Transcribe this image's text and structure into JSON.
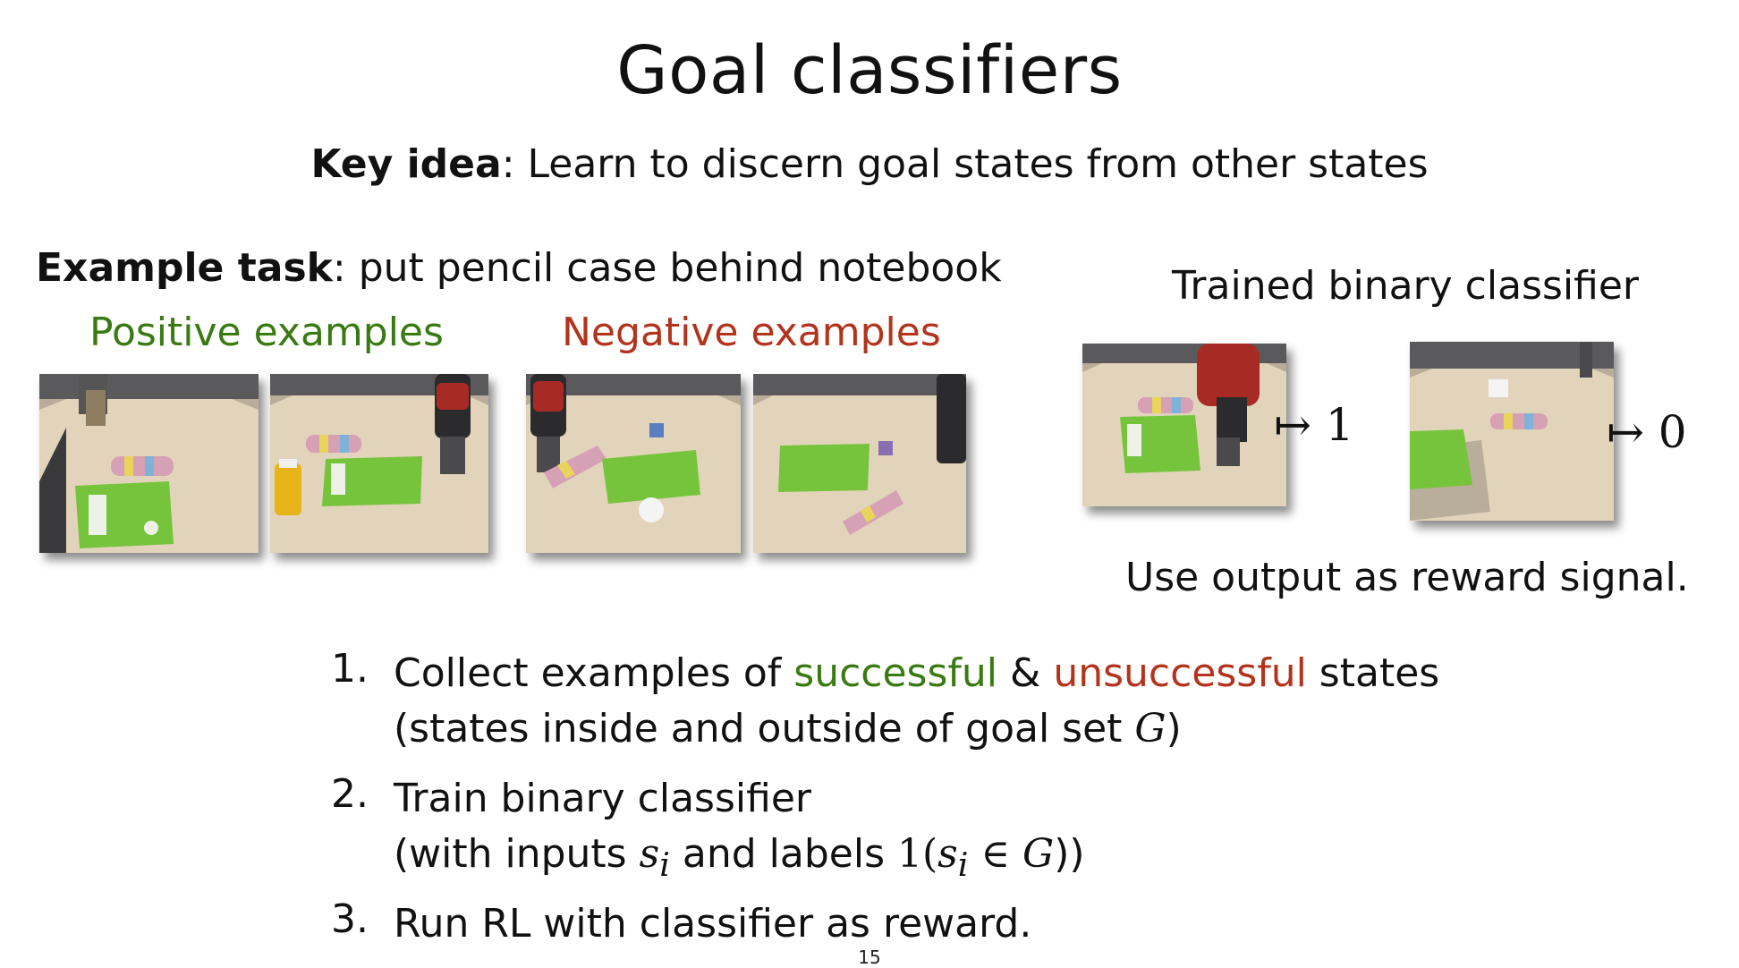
{
  "title": "Goal classifiers",
  "key_idea": {
    "label": "Key idea",
    "text": ": Learn to discern goal states from other states"
  },
  "example_task": {
    "label": "Example task",
    "text": ": put pencil case behind notebook"
  },
  "positive_heading": "Positive examples",
  "negative_heading": "Negative examples",
  "classifier_heading": "Trained binary classifier",
  "classifier_outputs": [
    "↦ 1",
    "↦ 0"
  ],
  "reward_note": "Use output as reward signal.",
  "steps": [
    {
      "number": "1.",
      "parts": [
        "Collect examples of ",
        "successful",
        " & ",
        "unsuccessful",
        " states"
      ],
      "sub_parts": [
        "(states inside and outside of goal set ",
        "G",
        ")"
      ]
    },
    {
      "number": "2.",
      "text": "Train binary classifier",
      "sub_parts": [
        "(with inputs ",
        "s",
        "i",
        " and labels ",
        "1(",
        "s",
        "i",
        " ∈ ",
        "G",
        "))"
      ]
    },
    {
      "number": "3.",
      "text": "Run RL with classifier as reward."
    }
  ],
  "page_number": "15",
  "colors": {
    "positive": "#3a7a12",
    "negative": "#b3331c"
  }
}
